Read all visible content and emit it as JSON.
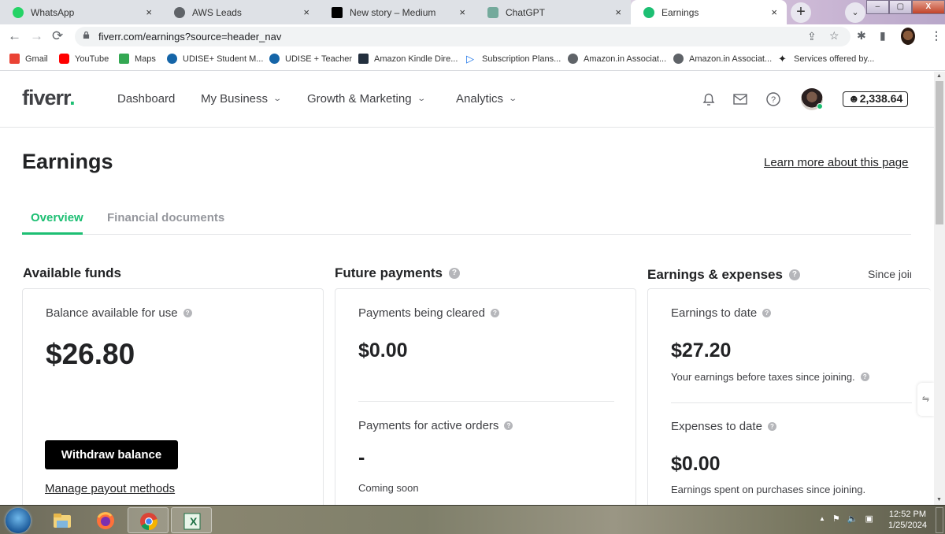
{
  "browser": {
    "tabs": [
      {
        "label": "WhatsApp",
        "icon": "whatsapp-icon",
        "color": "#25d366",
        "active": false
      },
      {
        "label": "AWS Leads",
        "icon": "globe-icon",
        "color": "#5f6368",
        "active": false
      },
      {
        "label": "New story – Medium",
        "icon": "medium-icon",
        "color": "#000000",
        "active": false
      },
      {
        "label": "ChatGPT",
        "icon": "chatgpt-icon",
        "color": "#74aa9c",
        "active": false
      },
      {
        "label": "Earnings",
        "icon": "fiverr-icon",
        "color": "#1dbf73",
        "active": true
      }
    ],
    "tab_close": "×",
    "new_tab": "+",
    "tab_search": "⌄",
    "window_controls": {
      "minimize": "–",
      "maximize": "▢",
      "close": "X"
    },
    "nav": {
      "back": "←",
      "forward": "→",
      "reload": "⟳"
    },
    "url": "fiverr.com/earnings?source=header_nav",
    "toolbar_icons": {
      "share": "⇪",
      "star": "☆",
      "extensions": "✱",
      "sidepanel": "▮",
      "menu": "⋮"
    },
    "bookmarks": [
      {
        "label": "Gmail",
        "color": "#ea4335"
      },
      {
        "label": "YouTube",
        "color": "#ff0000"
      },
      {
        "label": "Maps",
        "color": "#34a853"
      },
      {
        "label": "UDISE+ Student M...",
        "color": "#1565a8"
      },
      {
        "label": "UDISE + Teacher",
        "color": "#1565a8"
      },
      {
        "label": "Amazon Kindle Dire...",
        "color": "#232f3e"
      },
      {
        "label": "Subscription Plans...",
        "color": "#1a73e8"
      },
      {
        "label": "Amazon.in Associat...",
        "color": "#5f6368"
      },
      {
        "label": "Amazon.in Associat...",
        "color": "#5f6368"
      },
      {
        "label": "Services offered by...",
        "color": "#222222"
      }
    ]
  },
  "header": {
    "logo": "fiverr",
    "logo_dot": ".",
    "nav": [
      {
        "label": "Dashboard",
        "has_dropdown": false
      },
      {
        "label": "My Business",
        "has_dropdown": true
      },
      {
        "label": "Growth & Marketing",
        "has_dropdown": true
      },
      {
        "label": "Analytics",
        "has_dropdown": true
      }
    ],
    "chevron": "⌄",
    "credits": "☻2,338.64",
    "online_status_color": "#1dbf73"
  },
  "page": {
    "title": "Earnings",
    "learn_more": "Learn more about this page",
    "tabs": [
      {
        "label": "Overview",
        "active": true
      },
      {
        "label": "Financial documents",
        "active": false
      }
    ],
    "accent_color": "#1dbf73",
    "help_glyph": "?",
    "sections": {
      "available": {
        "heading": "Available funds",
        "balance_label": "Balance available for use",
        "balance_value": "$26.80",
        "withdraw_button": "Withdraw balance",
        "manage_link": "Manage payout methods"
      },
      "future": {
        "heading": "Future payments",
        "cleared_label": "Payments being cleared",
        "cleared_value": "$0.00",
        "active_label": "Payments for active orders",
        "active_value": "-",
        "active_note": "Coming soon"
      },
      "earnings": {
        "heading": "Earnings & expenses",
        "period": "Since joining",
        "earnings_label": "Earnings to date",
        "earnings_value": "$27.20",
        "earnings_note": "Your earnings before taxes since joining.",
        "expenses_label": "Expenses to date",
        "expenses_value": "$0.00",
        "expenses_note": "Earnings spent on purchases since joining."
      }
    },
    "side_handle": "⇋"
  },
  "taskbar": {
    "apps": [
      {
        "name": "file-explorer",
        "open": false
      },
      {
        "name": "firefox",
        "open": false
      },
      {
        "name": "chrome",
        "open": true
      },
      {
        "name": "excel",
        "open": true
      }
    ],
    "tray": {
      "up": "▲",
      "flag": "⚑",
      "volume": "🔈",
      "network": "▣"
    },
    "time": "12:52 PM",
    "date": "1/25/2024"
  }
}
